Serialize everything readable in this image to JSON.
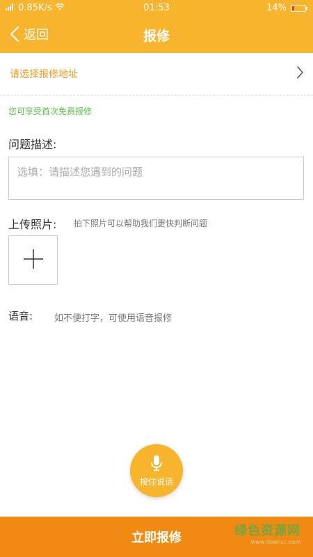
{
  "status_bar": {
    "signal": "0.85K/s",
    "time": "01:53",
    "battery": "14%"
  },
  "header": {
    "back_label": "返回",
    "title": "报修"
  },
  "address": {
    "label": "请选择报修地址"
  },
  "free_notice": "您可享受首次免费报修",
  "description": {
    "label": "问题描述:",
    "placeholder": "选填：请描述您遇到的问题"
  },
  "photos": {
    "label": "上传照片:",
    "hint": "拍下照片可以帮助我们更快判断问题"
  },
  "voice": {
    "label": "语音:",
    "hint": "如不便打字，可使用语音报修",
    "button_label": "按住说话"
  },
  "submit_label": "立即报修",
  "watermark": {
    "title": "绿色资源网",
    "url": "www.downcc.com"
  },
  "colors": {
    "primary": "#f9b42d",
    "submit": "#f08a12",
    "address_text": "#f39a1f",
    "notice_green": "#5bbf4a"
  }
}
